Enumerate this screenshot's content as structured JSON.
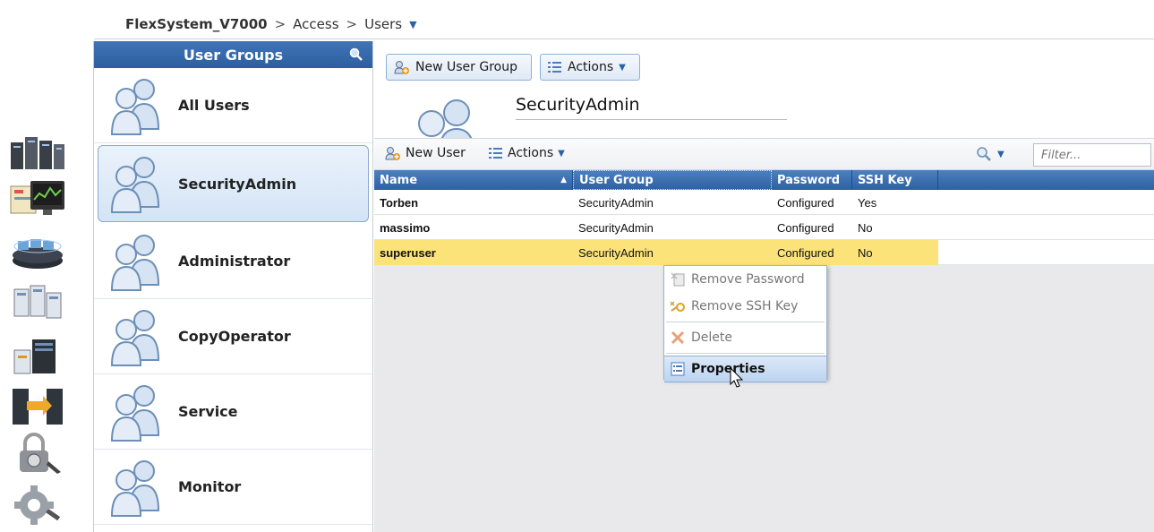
{
  "breadcrumb": {
    "system": "FlexSystem_V7000",
    "sep1": ">",
    "section": "Access",
    "sep2": ">",
    "page": "Users",
    "caret": "▼"
  },
  "rail": {
    "icons": [
      "home-icon",
      "monitoring-icon",
      "pools-icon",
      "volumes-icon",
      "hosts-icon",
      "copy-services-icon",
      "access-icon",
      "settings-icon"
    ]
  },
  "groups": {
    "header": "User Groups",
    "items": [
      {
        "label": "All Users",
        "selected": false
      },
      {
        "label": "SecurityAdmin",
        "selected": true
      },
      {
        "label": "Administrator",
        "selected": false
      },
      {
        "label": "CopyOperator",
        "selected": false
      },
      {
        "label": "Service",
        "selected": false
      },
      {
        "label": "Monitor",
        "selected": false
      }
    ]
  },
  "toolbar": {
    "new_group_label": "New User Group",
    "actions_label": "Actions",
    "caret": "▼"
  },
  "detail": {
    "group_name": "SecurityAdmin"
  },
  "users_toolbar": {
    "new_user_label": "New User",
    "actions_label": "Actions",
    "caret": "▼",
    "filter_placeholder": "Filter..."
  },
  "table": {
    "columns": [
      "Name",
      "User Group",
      "Password",
      "SSH Key"
    ],
    "sort_indicator": "▲",
    "rows": [
      {
        "name": "Torben",
        "group": "SecurityAdmin",
        "password": "Configured",
        "ssh": "Yes"
      },
      {
        "name": "massimo",
        "group": "SecurityAdmin",
        "password": "Configured",
        "ssh": "No"
      },
      {
        "name": "superuser",
        "group": "SecurityAdmin",
        "password": "Configured",
        "ssh": "No"
      }
    ]
  },
  "context_menu": {
    "remove_password": "Remove Password",
    "remove_ssh_key": "Remove SSH Key",
    "delete": "Delete",
    "properties": "Properties"
  },
  "colors": {
    "header_blue": "#2e60a4",
    "highlight_yellow": "#fbe37a",
    "selected_bg": "#d4e4f6"
  }
}
